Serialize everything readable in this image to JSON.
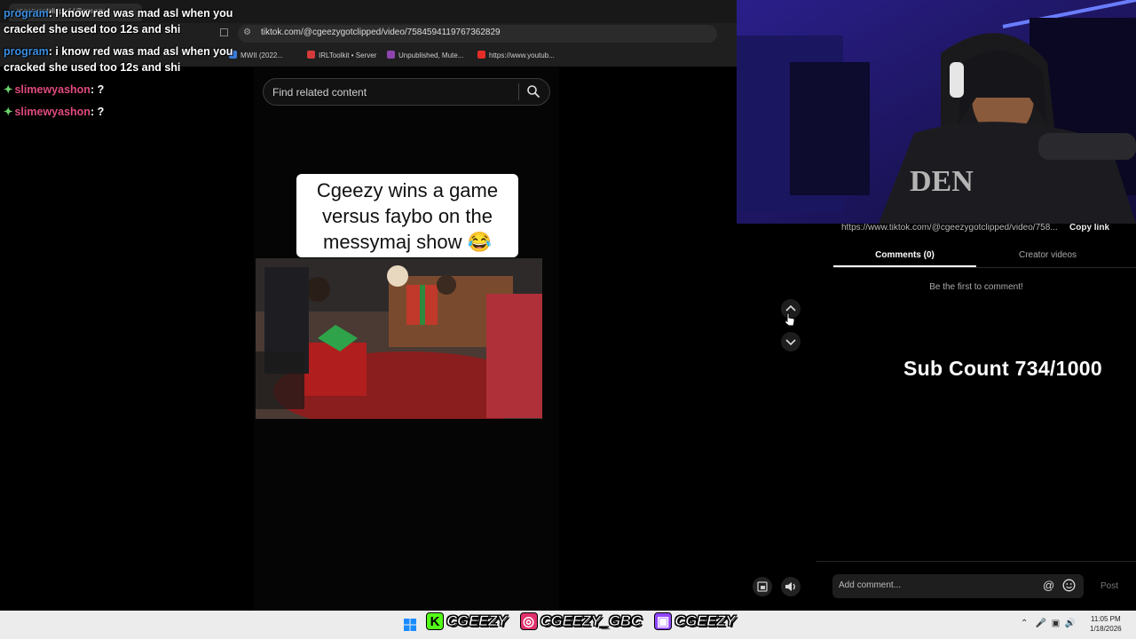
{
  "browser": {
    "tab_title": "cgeezygotclipped (@cgeezy...",
    "url": "tiktok.com/@cgeezygotclipped/video/7584594119767362829",
    "bookmarks": [
      {
        "label": "MWII (2022...",
        "color": "#3a7bd5"
      },
      {
        "label": "IRLToolkit • Server",
        "color": "#d43a3a"
      },
      {
        "label": "Unpublished, Mute...",
        "color": "#8e44ad"
      },
      {
        "label": "https://www.youtub...",
        "color": "#e52d27"
      }
    ]
  },
  "chat": {
    "messages": [
      {
        "user": "program",
        "sep": ": ",
        "text": "I know red was mad asl when you cracked she used too 12s and shi"
      },
      {
        "user": "program",
        "sep": ": ",
        "text": "i know red was mad asl when you cracked she used too 12s and shi"
      },
      {
        "user": "slimewyashon",
        "sep": ": ",
        "text": "?"
      },
      {
        "user": "slimewyashon",
        "sep": ": ",
        "text": "?"
      }
    ]
  },
  "tiktok": {
    "search_placeholder": "Find related content",
    "caption": "Cgeezy wins a game versus faybo on the messymaj show 😂",
    "share_url": "https://www.tiktok.com/@cgeezygotclipped/video/758...",
    "copy_link": "Copy link",
    "tab_comments": "Comments (0)",
    "tab_creator": "Creator videos",
    "empty_comments": "Be the first to comment!",
    "comment_placeholder": "Add comment...",
    "at_symbol": "@",
    "post": "Post"
  },
  "overlay": {
    "sub_count": "Sub Count 734/1000"
  },
  "taskbar": {
    "socials": [
      {
        "platform": "kick",
        "badge": "K",
        "color": "#53fc18",
        "handle": "CGEEZY"
      },
      {
        "platform": "instagram",
        "badge": "◎",
        "color": "#e1306c",
        "handle": "CGEEZY_GBC"
      },
      {
        "platform": "twitch",
        "badge": "▣",
        "color": "#9146ff",
        "handle": "CGEEZY"
      }
    ],
    "time": "11:05 PM",
    "date": "1/18/2026"
  },
  "colors": {
    "accent_blue": "#3b8de0",
    "username_pink": "#e04a7f"
  }
}
